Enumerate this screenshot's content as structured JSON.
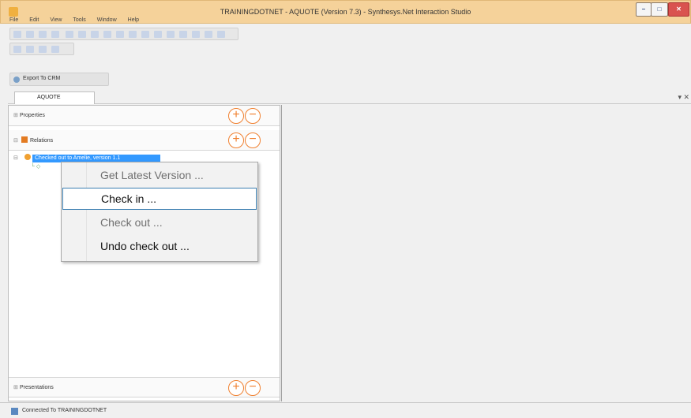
{
  "window": {
    "title": "TRAININGDOTNET - AQUOTE (Version 7.3) - Synthesys.Net Interaction Studio",
    "minimize": "–",
    "maximize": "□",
    "close": "✕"
  },
  "menu": {
    "items": [
      "File",
      "Edit",
      "View",
      "Tools",
      "Window",
      "Help"
    ]
  },
  "toolbar": {
    "export_label": "Export To CRM"
  },
  "document": {
    "tab_label": "AQUOTE",
    "pane_close": "▾ ✕"
  },
  "left_pane": {
    "properties_label": "Properties",
    "relations_label": "Relations",
    "presentations_label": "Presentations",
    "add_symbol": "+",
    "remove_symbol": "−",
    "tree_node_label": "Checked out to Amelie, version 1.1"
  },
  "context_menu": {
    "items": [
      {
        "label": "Get Latest Version ...",
        "state": "disabled"
      },
      {
        "label": "Check in ...",
        "state": "hover"
      },
      {
        "label": "Check out ...",
        "state": "disabled"
      },
      {
        "label": "Undo check out ...",
        "state": "enabled"
      }
    ]
  },
  "status": {
    "text": "Connected To TRAININGDOTNET"
  },
  "colors": {
    "titlebar": "#f5d29a",
    "accent_orange": "#f08030",
    "selection": "#3399ff",
    "hover_border": "#3c7fb1"
  }
}
